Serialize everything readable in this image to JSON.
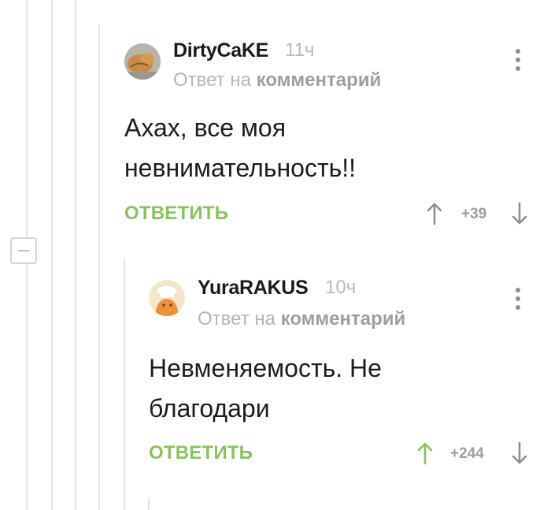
{
  "comments": [
    {
      "author": "DirtyCaKE",
      "time": "11ч",
      "reply_prefix": "Ответ на",
      "reply_target": "комментарий",
      "text": "Ахах, все моя невнимательность!!",
      "reply_label": "ОТВЕТИТЬ",
      "rating": "+39",
      "upvote_color": "#8f8f8f"
    },
    {
      "author": "YuraRAKUS",
      "time": "10ч",
      "reply_prefix": "Ответ на",
      "reply_target": "комментарий",
      "text": "Невменяемость. Не благодари",
      "reply_label": "ОТВЕТИТЬ",
      "rating": "+244",
      "upvote_color": "#8ac25d"
    }
  ],
  "colors": {
    "accent": "#8ac25d",
    "muted": "#b5b5b5",
    "thread_line": "#e3e3e3"
  },
  "icons": [
    "collapse-icon",
    "upvote-icon",
    "downvote-icon",
    "more-options-icon"
  ]
}
